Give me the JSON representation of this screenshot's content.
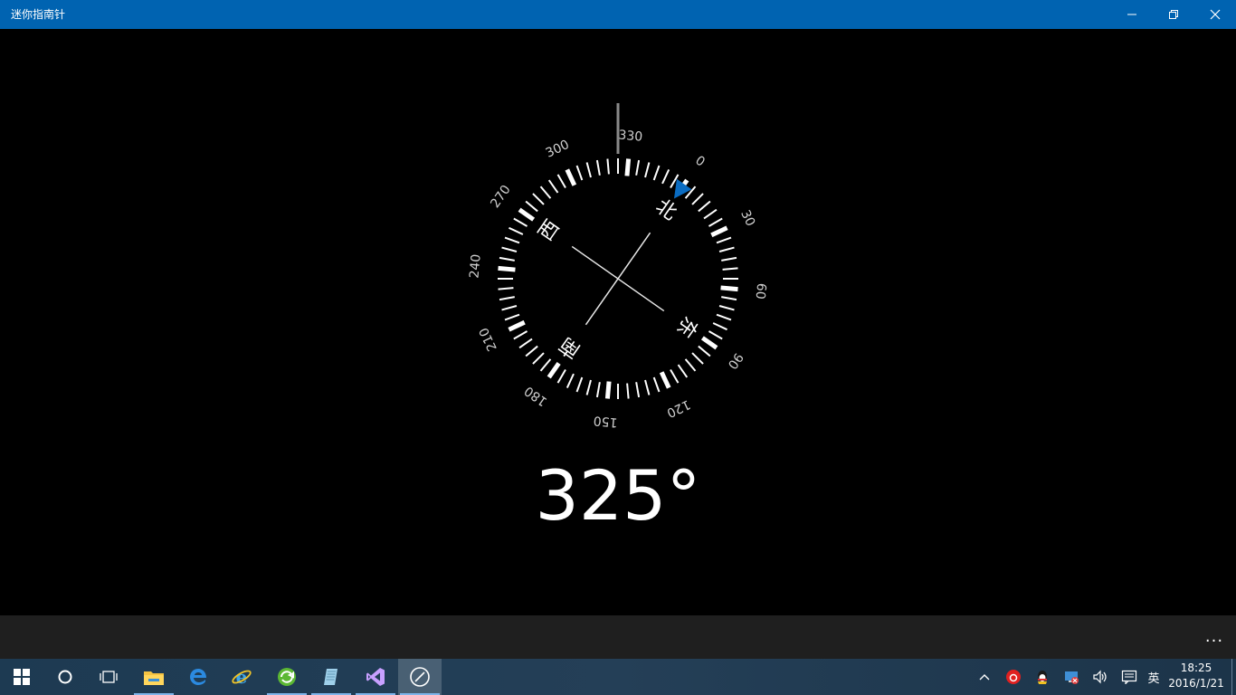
{
  "window": {
    "title": "迷你指南针",
    "controls": [
      "minimize",
      "restore",
      "close"
    ],
    "accent_color": "#0063b1"
  },
  "compass": {
    "heading_display": "325°",
    "heading_degrees": 325,
    "cardinal_labels": {
      "north": "北",
      "east": "东",
      "south": "南",
      "west": "西"
    },
    "scale_labels": [
      "0",
      "30",
      "60",
      "90",
      "120",
      "150",
      "180",
      "210",
      "240",
      "270",
      "300",
      "330"
    ],
    "north_marker_color": "#0a6cc2"
  },
  "app_bar": {
    "more_label": "..."
  },
  "taskbar": {
    "apps": [
      {
        "name": "start-icon"
      },
      {
        "name": "cortana-icon"
      },
      {
        "name": "task-view-icon"
      },
      {
        "name": "file-explorer-icon"
      },
      {
        "name": "edge-icon"
      },
      {
        "name": "internet-explorer-icon"
      },
      {
        "name": "browser-icon"
      },
      {
        "name": "notepad-icon"
      },
      {
        "name": "visual-studio-icon"
      },
      {
        "name": "compass-app-icon"
      }
    ],
    "tray": {
      "ime_label": "英",
      "time": "18:25",
      "date": "2016/1/21"
    }
  }
}
